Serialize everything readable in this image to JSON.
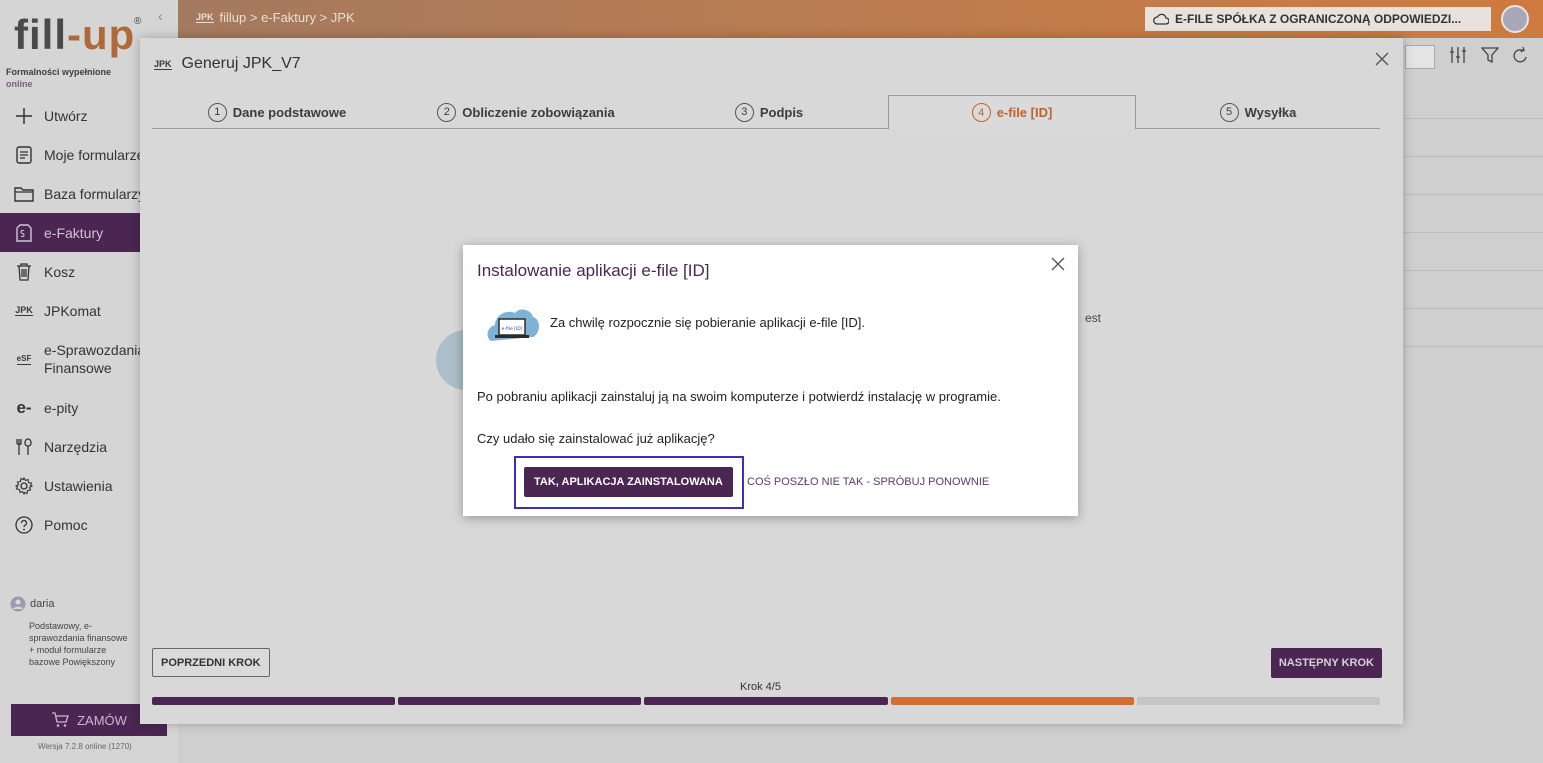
{
  "app": {
    "logo_main": "fill",
    "logo_dash": "-",
    "logo_accent": "up",
    "logo_reg": "®",
    "tagline_line1": "Formalności wypełnione",
    "tagline_line2": "online"
  },
  "topbar": {
    "collapse_glyph": "‹",
    "crumb_badge": "JPK",
    "breadcrumb": "fillup > e-Faktury > JPK",
    "company": "E-FILE SPÓŁKA Z OGRANICZONĄ ODPOWIEDZI..."
  },
  "sidebar": {
    "items": [
      {
        "label": "Utwórz",
        "icon": "plus-icon"
      },
      {
        "label": "Moje formularze",
        "icon": "document-icon"
      },
      {
        "label": "Baza formularzy",
        "icon": "folder-icon"
      },
      {
        "label": "e-Faktury",
        "icon": "invoice-icon",
        "active": true
      },
      {
        "label": "Kosz",
        "icon": "trash-icon"
      },
      {
        "label": "JPKomat",
        "icon": "jpk-icon",
        "badge": "JPK"
      },
      {
        "label": "e-Sprawozdania",
        "label2": "Finansowe",
        "icon": "esf-icon",
        "badge": "eSF"
      },
      {
        "label": "e-pity",
        "icon": "epity-icon",
        "badge": "e-"
      },
      {
        "label": "Narzędzia",
        "icon": "tools-icon"
      },
      {
        "label": "Ustawienia",
        "icon": "settings-icon"
      },
      {
        "label": "Pomoc",
        "icon": "help-icon"
      }
    ],
    "user": {
      "name": "daria",
      "plan": "Podstawowy, e-sprawozdania finansowe + moduł formularze bazowe Powiększony"
    },
    "order_label": "ZAMÓW",
    "version": "Wersja 7.2.8 online (1270)"
  },
  "modal": {
    "badge": "JPK",
    "title": "Generuj JPK_V7",
    "tabs": [
      {
        "num": "1",
        "label": "Dane podstawowe"
      },
      {
        "num": "2",
        "label": "Obliczenie zobowiązania"
      },
      {
        "num": "3",
        "label": "Podpis"
      },
      {
        "num": "4",
        "label": "e-file [ID]",
        "active": true
      },
      {
        "num": "5",
        "label": "Wysyłka"
      }
    ],
    "hidden_text": "est",
    "prev_label": "POPRZEDNI KROK",
    "next_label": "NASTĘPNY KROK",
    "step_label": "Krok 4/5",
    "progress_colors": [
      "#4b2652",
      "#4b2652",
      "#4b2652",
      "#cf6f35",
      "#c5c5c5"
    ]
  },
  "dialog": {
    "title": "Instalowanie aplikacji e-file [ID]",
    "icon_text": "e-file [ID]",
    "line1": "Za chwilę rozpocznie się pobieranie aplikacji e-file [ID].",
    "line2": "Po pobraniu aplikacji zainstaluj ją na swoim komputerze i potwierdź instalację w programie.",
    "line3": "Czy udało się zainstalować już aplikację?",
    "yes_label": "TAK, APLIKACJA ZAINSTALOWANA",
    "retry_label": "COŚ POSZŁO NIE TAK - SPRÓBUJ PONOWNIE"
  },
  "colors": {
    "brand_purple": "#4b2652",
    "accent_orange": "#cf6f35",
    "focus_blue": "#3d2fbd"
  }
}
